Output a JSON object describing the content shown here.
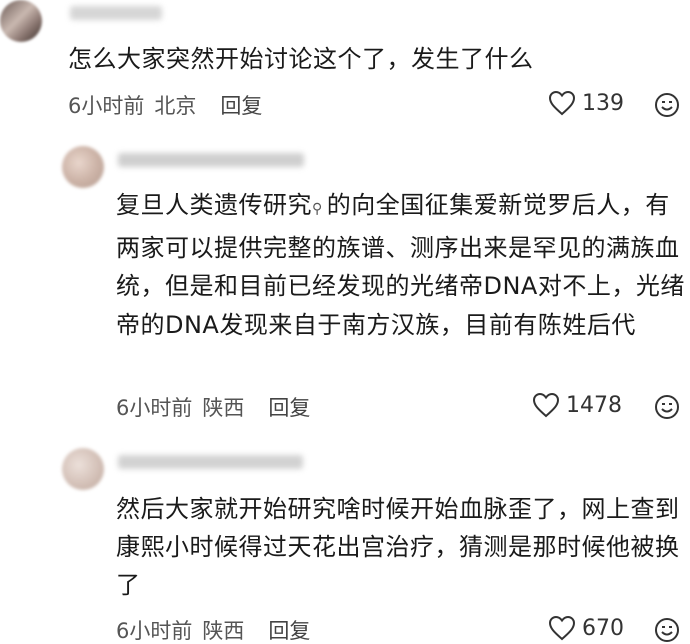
{
  "comments": [
    {
      "text": "怎么大家突然开始讨论这个了，发生了什么",
      "time": "6小时前",
      "location": "北京",
      "reply_label": "回复",
      "likes": "139"
    },
    {
      "text_before": "复旦人类遗传研究",
      "text_after": "的向全国征集爱新觉罗后人，有两家可以提供完整的族谱、测序出来是罕见的满族血统，但是和目前已经发现的光绪帝DNA对不上，光绪帝的DNA发现来自于南方汉族，目前有陈姓后代",
      "time": "6小时前",
      "location": "陕西",
      "reply_label": "回复",
      "likes": "1478"
    },
    {
      "text": "然后大家就开始研究啥时候开始血脉歪了，网上查到康熙小时候得过天花出宫治疗，猜测是那时候他被换了",
      "time": "6小时前",
      "location": "陕西",
      "reply_label": "回复",
      "likes": "670"
    }
  ],
  "icons": {
    "like": "heart-outline-icon",
    "emoji": "smiley-face-icon",
    "search": "search-icon"
  },
  "colors": {
    "text": "#1a1a1a",
    "meta": "#555555"
  }
}
